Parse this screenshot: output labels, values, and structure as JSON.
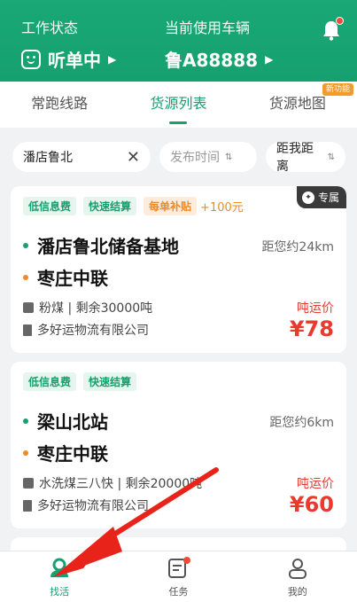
{
  "header": {
    "work_status_caption": "工作状态",
    "work_status_value": "听单中",
    "vehicle_caption": "当前使用车辆",
    "vehicle_value": "鲁A88888",
    "dropdown_glyph": "▶",
    "icons": [
      "smile-face-icon",
      "bell-icon"
    ],
    "bell_has_dot": true
  },
  "tabs": [
    {
      "label": "常跑线路",
      "active": false
    },
    {
      "label": "货源列表",
      "active": true
    },
    {
      "label": "货源地图",
      "active": false,
      "badge": "新功能"
    }
  ],
  "filters": {
    "search_value": "潘店鲁北",
    "clear_glyph": "✕",
    "time_label": "发布时间",
    "distance_label": "距我距离",
    "sort_glyph": "⇅"
  },
  "cards": [
    {
      "tags": [
        "低信息费",
        "快速结算",
        "每单补贴"
      ],
      "bonus": "+100元",
      "exclusive": "专属",
      "origin": "潘店鲁北储备基地",
      "distance": "距您约24km",
      "destination": "枣庄中联",
      "goods": "粉煤 | 剩余30000吨",
      "company": "多好运物流有限公司",
      "price_label": "吨运价",
      "price": "¥78"
    },
    {
      "tags": [
        "低信息费",
        "快速结算"
      ],
      "origin": "梁山北站",
      "distance": "距您约6km",
      "destination": "枣庄中联",
      "goods": "水洗煤三八快 | 剩余20000吨",
      "company": "多好运物流有限公司",
      "price_label": "吨运价",
      "price": "¥60"
    }
  ],
  "bottom_nav": [
    {
      "label": "找活",
      "icon": "person-pin-icon",
      "active": true
    },
    {
      "label": "任务",
      "icon": "task-list-icon",
      "active": false,
      "dot": true
    },
    {
      "label": "我的",
      "icon": "user-profile-icon",
      "active": false
    }
  ],
  "colors": {
    "brand_green": "#17a070",
    "price_red": "#e83a2e",
    "accent_orange": "#f08a24",
    "annotation_arrow": "#e8231a"
  }
}
